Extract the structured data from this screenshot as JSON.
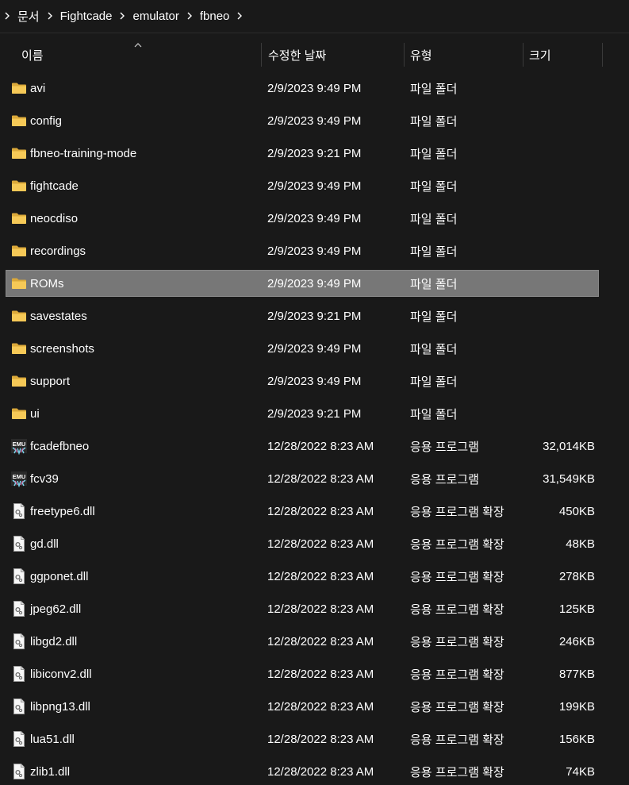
{
  "breadcrumb": [
    {
      "label": "문서"
    },
    {
      "label": "Fightcade"
    },
    {
      "label": "emulator"
    },
    {
      "label": "fbneo"
    }
  ],
  "columns": {
    "name": "이름",
    "date": "수정한 날짜",
    "type": "유형",
    "size": "크기"
  },
  "sort": {
    "column": "name",
    "direction": "ascending"
  },
  "colors": {
    "background": "#191919",
    "selected_row": "#777777",
    "folder": "#f2c14e"
  },
  "files": [
    {
      "name": "avi",
      "date": "2/9/2023 9:49 PM",
      "type": "파일 폴더",
      "size": "",
      "icon": "folder-icon",
      "selected": false
    },
    {
      "name": "config",
      "date": "2/9/2023 9:49 PM",
      "type": "파일 폴더",
      "size": "",
      "icon": "folder-icon",
      "selected": false
    },
    {
      "name": "fbneo-training-mode",
      "date": "2/9/2023 9:21 PM",
      "type": "파일 폴더",
      "size": "",
      "icon": "folder-icon",
      "selected": false
    },
    {
      "name": "fightcade",
      "date": "2/9/2023 9:49 PM",
      "type": "파일 폴더",
      "size": "",
      "icon": "folder-icon",
      "selected": false
    },
    {
      "name": "neocdiso",
      "date": "2/9/2023 9:49 PM",
      "type": "파일 폴더",
      "size": "",
      "icon": "folder-icon",
      "selected": false
    },
    {
      "name": "recordings",
      "date": "2/9/2023 9:49 PM",
      "type": "파일 폴더",
      "size": "",
      "icon": "folder-icon",
      "selected": false
    },
    {
      "name": "ROMs",
      "date": "2/9/2023 9:49 PM",
      "type": "파일 폴더",
      "size": "",
      "icon": "folder-icon",
      "selected": true
    },
    {
      "name": "savestates",
      "date": "2/9/2023 9:21 PM",
      "type": "파일 폴더",
      "size": "",
      "icon": "folder-icon",
      "selected": false
    },
    {
      "name": "screenshots",
      "date": "2/9/2023 9:49 PM",
      "type": "파일 폴더",
      "size": "",
      "icon": "folder-icon",
      "selected": false
    },
    {
      "name": "support",
      "date": "2/9/2023 9:49 PM",
      "type": "파일 폴더",
      "size": "",
      "icon": "folder-icon",
      "selected": false
    },
    {
      "name": "ui",
      "date": "2/9/2023 9:21 PM",
      "type": "파일 폴더",
      "size": "",
      "icon": "folder-icon",
      "selected": false
    },
    {
      "name": "fcadefbneo",
      "date": "12/28/2022 8:23 AM",
      "type": "응용 프로그램",
      "size": "32,014KB",
      "icon": "emu-app-icon",
      "selected": false
    },
    {
      "name": "fcv39",
      "date": "12/28/2022 8:23 AM",
      "type": "응용 프로그램",
      "size": "31,549KB",
      "icon": "emu-app-icon",
      "selected": false
    },
    {
      "name": "freetype6.dll",
      "date": "12/28/2022 8:23 AM",
      "type": "응용 프로그램 확장",
      "size": "450KB",
      "icon": "dll-file-icon",
      "selected": false
    },
    {
      "name": "gd.dll",
      "date": "12/28/2022 8:23 AM",
      "type": "응용 프로그램 확장",
      "size": "48KB",
      "icon": "dll-file-icon",
      "selected": false
    },
    {
      "name": "ggponet.dll",
      "date": "12/28/2022 8:23 AM",
      "type": "응용 프로그램 확장",
      "size": "278KB",
      "icon": "dll-file-icon",
      "selected": false
    },
    {
      "name": "jpeg62.dll",
      "date": "12/28/2022 8:23 AM",
      "type": "응용 프로그램 확장",
      "size": "125KB",
      "icon": "dll-file-icon",
      "selected": false
    },
    {
      "name": "libgd2.dll",
      "date": "12/28/2022 8:23 AM",
      "type": "응용 프로그램 확장",
      "size": "246KB",
      "icon": "dll-file-icon",
      "selected": false
    },
    {
      "name": "libiconv2.dll",
      "date": "12/28/2022 8:23 AM",
      "type": "응용 프로그램 확장",
      "size": "877KB",
      "icon": "dll-file-icon",
      "selected": false
    },
    {
      "name": "libpng13.dll",
      "date": "12/28/2022 8:23 AM",
      "type": "응용 프로그램 확장",
      "size": "199KB",
      "icon": "dll-file-icon",
      "selected": false
    },
    {
      "name": "lua51.dll",
      "date": "12/28/2022 8:23 AM",
      "type": "응용 프로그램 확장",
      "size": "156KB",
      "icon": "dll-file-icon",
      "selected": false
    },
    {
      "name": "zlib1.dll",
      "date": "12/28/2022 8:23 AM",
      "type": "응용 프로그램 확장",
      "size": "74KB",
      "icon": "dll-file-icon",
      "selected": false
    }
  ]
}
